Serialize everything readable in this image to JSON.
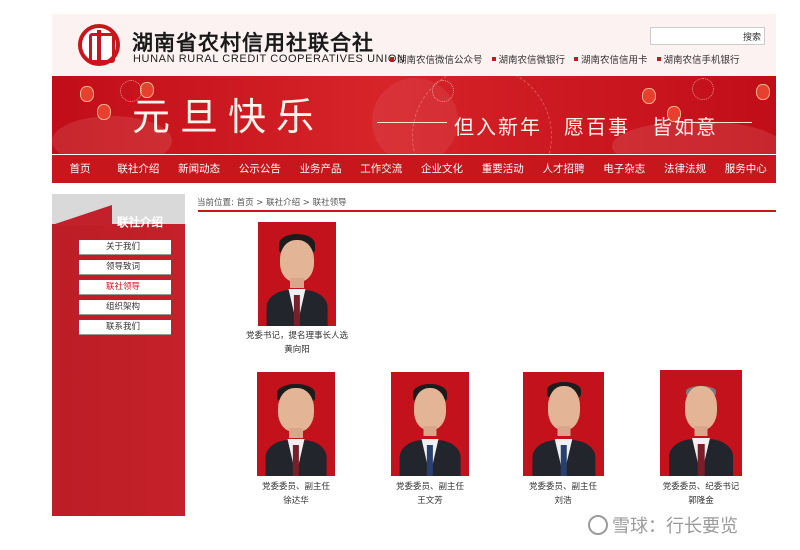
{
  "header": {
    "org_name_cn": "湖南省农村信用社联合社",
    "org_name_en": "HUNAN RURAL CREDIT COOPERATIVES UNION",
    "search_placeholder": "",
    "search_button": "搜索",
    "quick_links": [
      "湖南农信微信公众号",
      "湖南农信微银行",
      "湖南农信信用卡",
      "湖南农信手机银行"
    ]
  },
  "banner": {
    "title": "元旦快乐",
    "subtitle": "但入新年　愿百事　皆如意"
  },
  "nav": {
    "items": [
      "首页",
      "联社介绍",
      "新闻动态",
      "公示公告",
      "业务产品",
      "工作交流",
      "企业文化",
      "重要活动",
      "人才招聘",
      "电子杂志",
      "法律法规",
      "服务中心"
    ]
  },
  "sidebar": {
    "title": "联社介绍",
    "items": [
      "关于我们",
      "领导致词",
      "联社领导",
      "组织架构",
      "联系我们"
    ],
    "active_index": 2
  },
  "breadcrumb": "当前位置:  首页 > 联社介绍 > 联社领导",
  "leaders": [
    {
      "title": "党委书记，提名理事长人选",
      "name": "黄向阳"
    },
    {
      "title": "党委委员、副主任",
      "name": "徐达华"
    },
    {
      "title": "党委委员、副主任",
      "name": "王文芳"
    },
    {
      "title": "党委委员、副主任",
      "name": "刘浩"
    },
    {
      "title": "党委委员、纪委书记",
      "name": "郭隆金"
    }
  ],
  "watermark": "雪球：行长要览",
  "colors": {
    "brand_red": "#c8161d",
    "header_bg": "#fdf2f2"
  }
}
